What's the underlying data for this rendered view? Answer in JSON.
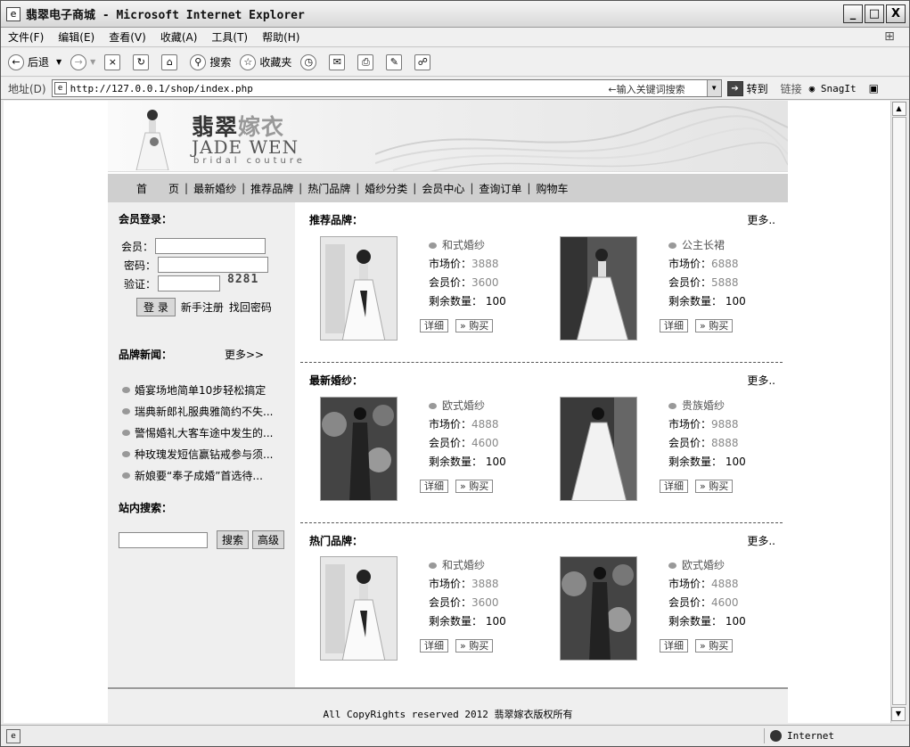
{
  "window": {
    "title": "翡翠电子商城 - Microsoft Internet Explorer",
    "minimize": "_",
    "maximize": "□",
    "close": "X"
  },
  "menu": [
    "文件(F)",
    "编辑(E)",
    "查看(V)",
    "收藏(A)",
    "工具(T)",
    "帮助(H)"
  ],
  "toolbar": {
    "back": "后退",
    "search": "搜索",
    "favorites": "收藏夹"
  },
  "address": {
    "label": "地址(D)",
    "url": "http://127.0.0.1/shop/index.php",
    "hint": "←输入关键词搜索",
    "go": "转到",
    "links": "链接",
    "snagit": "SnagIt"
  },
  "status": {
    "zone": "Internet"
  },
  "banner": {
    "logo_cn_a": "翡翠",
    "logo_cn_b": "嫁衣",
    "logo_en": "JADE WEN",
    "logo_sub": "bridal couture"
  },
  "nav": [
    "首　　页",
    "最新婚纱",
    "推荐品牌",
    "热门品牌",
    "婚纱分类",
    "会员中心",
    "查询订单",
    "购物车"
  ],
  "login": {
    "title": "会员登录：",
    "user_label": "会员：",
    "pass_label": "密码：",
    "code_label": "验证：",
    "captcha": "8281",
    "login_btn": "登 录",
    "register": "新手注册",
    "recover": "找回密码"
  },
  "brand_news": {
    "title": "品牌新闻：",
    "more": "更多>>",
    "items": [
      "婚宴场地简单10步轻松搞定",
      "瑞典新郎礼服典雅简约不失...",
      "警惕婚礼大客车途中发生的...",
      "种玫瑰发短信赢钻戒参与须...",
      "新娘要“奉子成婚”首选待..."
    ]
  },
  "site_search": {
    "title": "站内搜索：",
    "search_btn": "搜索",
    "advanced_btn": "高级"
  },
  "sections": [
    {
      "title": "推荐品牌：",
      "more": "更多..",
      "products": [
        {
          "name": "和式婚纱",
          "market_label": "市场价：",
          "market": "3888",
          "member_label": "会员价：",
          "member": "3600",
          "stock_label": "剩余数量：",
          "stock": "100",
          "detail": "详细",
          "buy": "购买"
        },
        {
          "name": "公主长裙",
          "market_label": "市场价：",
          "market": "6888",
          "member_label": "会员价：",
          "member": "5888",
          "stock_label": "剩余数量：",
          "stock": "100",
          "detail": "详细",
          "buy": "购买"
        }
      ]
    },
    {
      "title": "最新婚纱：",
      "more": "更多..",
      "products": [
        {
          "name": "欧式婚纱",
          "market_label": "市场价：",
          "market": "4888",
          "member_label": "会员价：",
          "member": "4600",
          "stock_label": "剩余数量：",
          "stock": "100",
          "detail": "详细",
          "buy": "购买"
        },
        {
          "name": "贵族婚纱",
          "market_label": "市场价：",
          "market": "9888",
          "member_label": "会员价：",
          "member": "8888",
          "stock_label": "剩余数量：",
          "stock": "100",
          "detail": "详细",
          "buy": "购买"
        }
      ]
    },
    {
      "title": "热门品牌：",
      "more": "更多..",
      "products": [
        {
          "name": "和式婚纱",
          "market_label": "市场价：",
          "market": "3888",
          "member_label": "会员价：",
          "member": "3600",
          "stock_label": "剩余数量：",
          "stock": "100",
          "detail": "详细",
          "buy": "购买"
        },
        {
          "name": "欧式婚纱",
          "market_label": "市场价：",
          "market": "4888",
          "member_label": "会员价：",
          "member": "4600",
          "stock_label": "剩余数量：",
          "stock": "100",
          "detail": "详细",
          "buy": "购买"
        }
      ]
    }
  ],
  "footer": "All CopyRights reserved 2012 翡翠嫁衣版权所有"
}
